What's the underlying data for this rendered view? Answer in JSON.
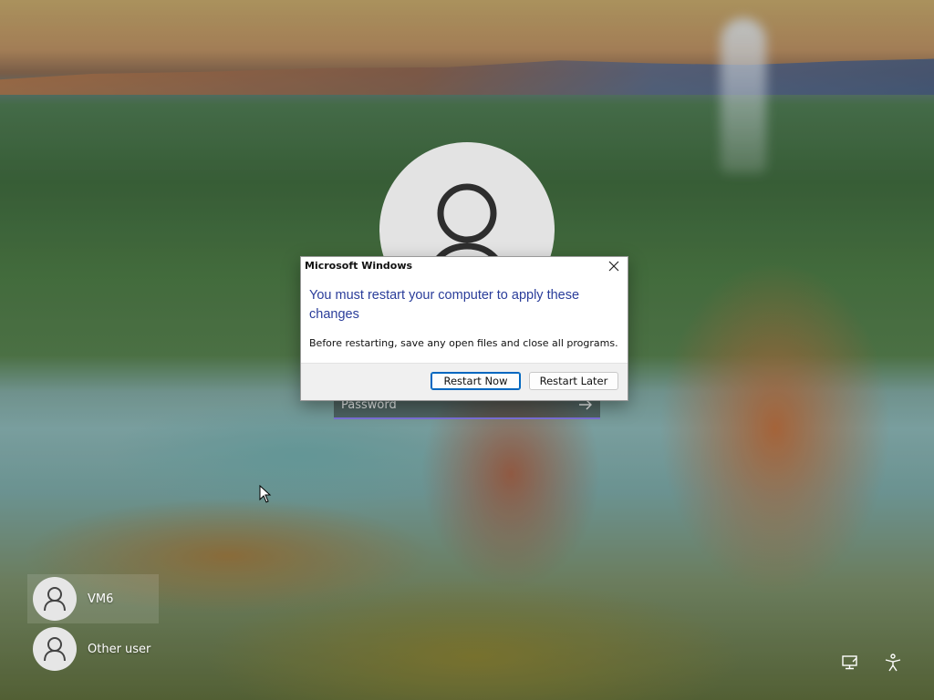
{
  "lock_screen": {
    "password_placeholder": "Password",
    "users": [
      {
        "name": "VM6",
        "selected": true
      },
      {
        "name": "Other user",
        "selected": false
      }
    ],
    "tray_icons": [
      "network-icon",
      "accessibility-icon"
    ]
  },
  "dialog": {
    "title": "Microsoft Windows",
    "heading": "You must restart your computer to apply these changes",
    "body": "Before restarting, save any open files and close all programs.",
    "buttons": {
      "restart_now": "Restart Now",
      "restart_later": "Restart Later"
    },
    "heading_color": "#2a3d9a"
  },
  "colors": {
    "accent": "#0067c0",
    "password_underline": "#7a6fd6"
  }
}
